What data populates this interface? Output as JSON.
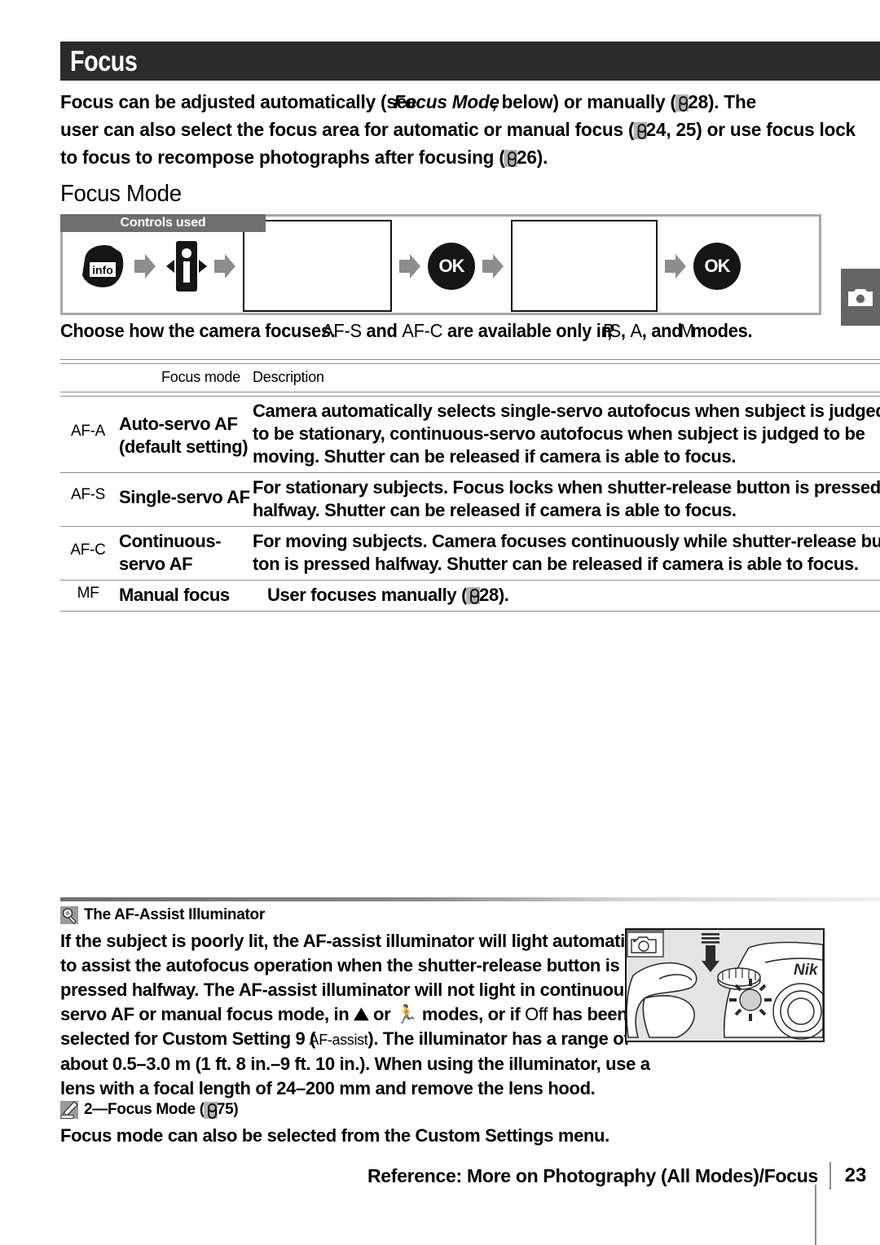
{
  "page": {
    "title": "Focus",
    "number": "23",
    "footer_title": "Reference: More on Photography (All Modes)/Focus"
  },
  "intro": {
    "line1_a": "Focus can be adjusted automatically (see",
    "line1_b": "Focus Mode",
    "line1_c": ", below) or manually (",
    "line1_d": "28).  The",
    "line2_a": "user can also select the focus area for automatic or manual focus (",
    "line2_b": "24, 25) or use focus lock",
    "line3_a": "to focus to recompose photographs after focusing (",
    "line3_b": "26)."
  },
  "focus_mode": {
    "heading": "Focus Mode",
    "controls_label": "Controls used",
    "controls": [
      {
        "name": "info-button",
        "label": "info"
      },
      {
        "name": "multi-selector",
        "label": "i"
      },
      {
        "name": "monitor-display-1",
        "label": ""
      },
      {
        "name": "ok-button-1",
        "label": "OK"
      },
      {
        "name": "monitor-display-2",
        "label": ""
      },
      {
        "name": "ok-button-2",
        "label": "OK"
      }
    ],
    "choose_a": "Choose how the camera focuses.",
    "choose_b": "AF-S",
    "choose_c": " and ",
    "choose_d": "AF-C",
    "choose_e": " are available only in ",
    "choose_f": "P",
    "choose_g": ", ",
    "choose_h": "S",
    "choose_i": ", ",
    "choose_j": "A",
    "choose_k": ", and ",
    "choose_l": "M",
    "choose_m": " modes."
  },
  "table": {
    "headers": {
      "code": "",
      "mode": "Focus mode",
      "description": "Description"
    },
    "rows": [
      {
        "code": "AF-A",
        "mode_line1": "Auto-servo AF",
        "mode_line2": "(default setting)",
        "desc_line1": "Camera automatically selects single-servo autofocus when subject is judged",
        "desc_line2": "to be stationary, continuous-servo autofocus when subject is judged to be",
        "desc_line3": "moving. Shutter can be released if camera is able to focus."
      },
      {
        "code": "AF-S",
        "mode_line1": "Single-servo AF",
        "mode_line2": "",
        "desc_line1": "For stationary subjects.  Focus locks when shutter-release button is pressed",
        "desc_line2": "halfway.  Shutter can be released if camera is able to focus.",
        "desc_line3": ""
      },
      {
        "code": "AF-C",
        "mode_line1": "Continuous-",
        "mode_line2": "servo AF",
        "desc_line1": "For moving subjects.  Camera focuses continuously while shutter-release but-",
        "desc_line2": "ton is pressed halfway.  Shutter can be released if camera is able to focus.",
        "desc_line3": ""
      },
      {
        "code": "MF",
        "mode_line1": "Manual focus",
        "mode_line2": "",
        "desc_line1": "User focuses manually (    28).",
        "desc_line2": "",
        "desc_line3": ""
      }
    ]
  },
  "note_illuminator": {
    "icon": "magnifier-icon",
    "heading": "The AF-Assist Illuminator",
    "line1": "If the subject is poorly lit, the AF-assist illuminator will light automatically",
    "line2": "to assist the autofocus operation when the shutter-release button is",
    "line3": "pressed halfway.  The AF-assist illuminator will not light in continuous-",
    "line4_a": "servo AF or manual focus mode, in ",
    "line4_b": " or ",
    "line4_c": " modes, or if ",
    "line4_d": "Off",
    "line4_e": " has been",
    "line5_a": "selected for Custom Setting 9 (",
    "line5_b": "AF-assist",
    "line5_c": ").  The illuminator has a range of",
    "line6": "about 0.5–3.0 m (1 ft.  8 in.–9 ft.  10 in.).  When using the illuminator, use a",
    "line7": "lens with a focal length of 24–200 mm and remove the lens hood."
  },
  "note_focus_mode": {
    "icon": "pencil-icon",
    "heading_a": "2—Focus Mode (",
    "heading_b": "75)",
    "body": "Focus mode can also be selected from the Custom Settings menu."
  },
  "colors": {
    "banner": "#2b2b2b",
    "controls_label_bg": "#6e6e6e",
    "rule": "#8d8d8d",
    "side_tab": "#656565",
    "note_icon": "#9a9a9a"
  }
}
